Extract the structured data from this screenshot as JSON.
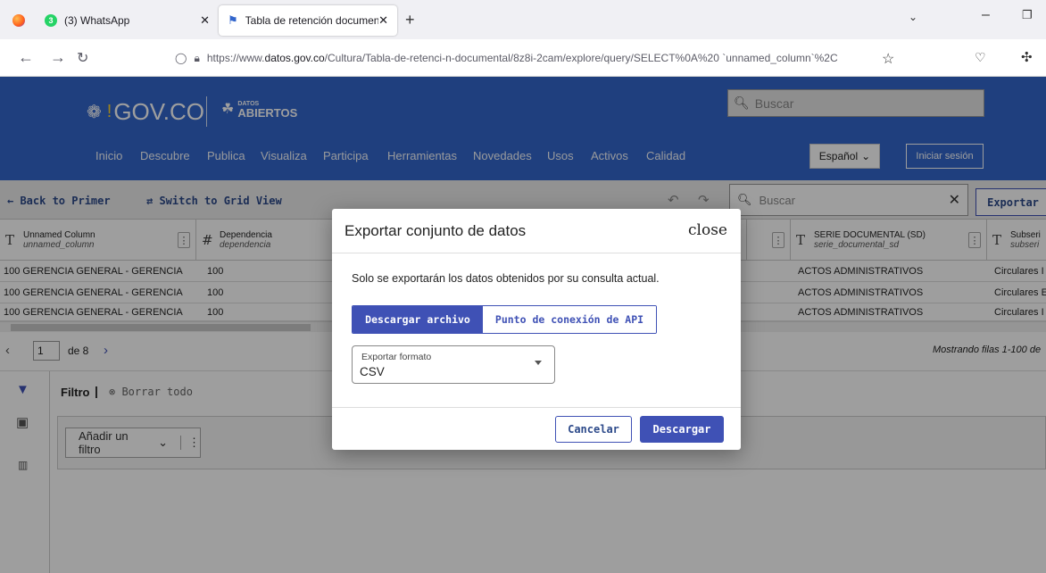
{
  "browser": {
    "tabs": [
      {
        "title": "(3) WhatsApp",
        "badge": "3"
      },
      {
        "title": "Tabla de retención documental |"
      }
    ],
    "new_tab": "+",
    "url_prefix": "https://www.",
    "url_domain": "datos.gov.co",
    "url_rest": "/Cultura/Tabla-de-retenci-n-documental/8z8i-2cam/explore/query/SELECT%0A%20 `unnamed_column`%2C"
  },
  "site": {
    "logo": "GOV.CO",
    "logo2_small": "DATOS",
    "logo2_big": "ABIERTOS",
    "search_placeholder": "Buscar",
    "menu": [
      "Inicio",
      "Descubre",
      "Publica",
      "Visualiza",
      "Participa",
      "Herramientas",
      "Novedades",
      "Usos",
      "Activos",
      "Calidad"
    ],
    "language": "Español",
    "login": "Iniciar sesión"
  },
  "toolbar": {
    "back": "Back to Primer",
    "grid": "Switch to Grid View",
    "search_placeholder": "Buscar",
    "export": "Exportar"
  },
  "table": {
    "columns": [
      {
        "type": "T",
        "name": "Unnamed Column",
        "field": "unnamed_column"
      },
      {
        "type": "#",
        "name": "Dependencia",
        "field": "dependencia"
      },
      {
        "type": "T",
        "name": "SERIE DOCUMENTAL (SD)",
        "field": "serie_documental_sd"
      },
      {
        "type": "T",
        "name": "Subseri",
        "field": "subseri"
      }
    ],
    "rows": [
      [
        "100 GERENCIA GENERAL - GERENCIA",
        "100",
        "ACTOS ADMINISTRATIVOS",
        "Circulares I"
      ],
      [
        "100 GERENCIA GENERAL - GERENCIA",
        "100",
        "ACTOS ADMINISTRATIVOS",
        "Circulares E"
      ],
      [
        "100 GERENCIA GENERAL - GERENCIA",
        "100",
        "ACTOS ADMINISTRATIVOS",
        "Circulares I"
      ]
    ],
    "page": "1",
    "of_pages": "de 8",
    "showing": "Mostrando filas 1-100 de"
  },
  "filter": {
    "title": "Filtro",
    "clear": "Borrar todo",
    "add": "Añadir un filtro"
  },
  "modal": {
    "title": "Exportar conjunto de datos",
    "close": "close",
    "message": "Solo se exportarán los datos obtenidos por su consulta actual.",
    "tab_download": "Descargar archivo",
    "tab_api": "Punto de conexión de API",
    "format_label": "Exportar formato",
    "format_value": "CSV",
    "cancel": "Cancelar",
    "download": "Descargar"
  },
  "colors": {
    "gov_blue": "#3366cc",
    "accent": "#3f51b5"
  }
}
